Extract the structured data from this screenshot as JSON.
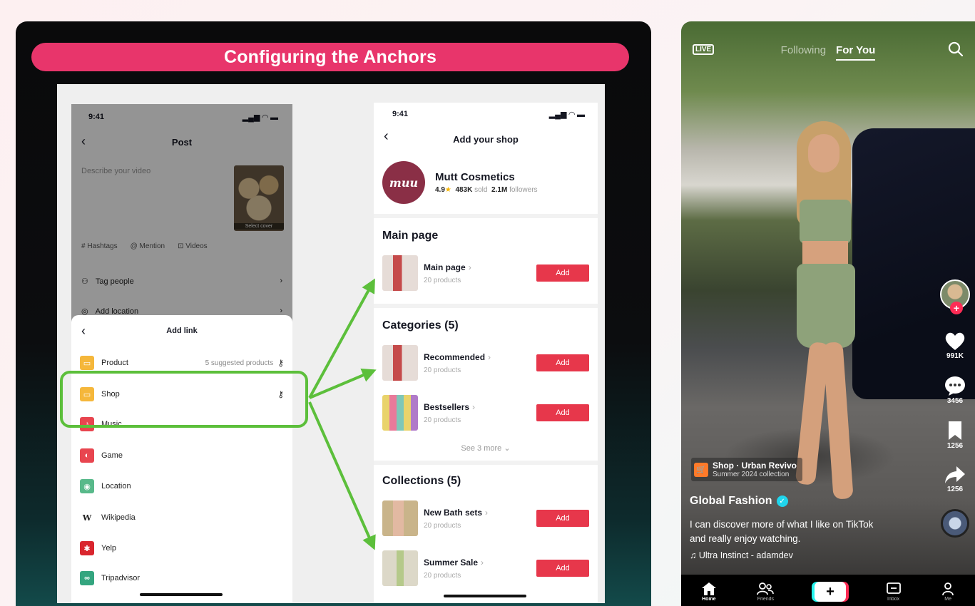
{
  "slide": {
    "banner": "Configuring the Anchors",
    "post_screen": {
      "time": "9:41",
      "title": "Post",
      "back": "‹",
      "description_placeholder": "Describe your video",
      "cover_label": "Select cover",
      "tags": [
        "# Hashtags",
        "@ Mention",
        "⊡ Videos"
      ],
      "tag_people": "Tag people",
      "add_location": "Add location"
    },
    "add_link_sheet": {
      "back": "‹",
      "title": "Add link",
      "items": [
        {
          "label": "Product",
          "right": "5 suggested products",
          "icon_color": "#f5b73b",
          "glyph": "▭"
        },
        {
          "label": "Shop",
          "right": "",
          "icon_color": "#f5b73b",
          "glyph": "▭"
        },
        {
          "label": "Music",
          "right": "",
          "icon_color": "#e8454f",
          "glyph": "♪"
        },
        {
          "label": "Game",
          "right": "",
          "icon_color": "#e8454f",
          "glyph": "◐"
        },
        {
          "label": "Location",
          "right": "",
          "icon_color": "#58b98a",
          "glyph": "◉"
        },
        {
          "label": "Wikipedia",
          "right": "",
          "icon_color": "#ffffff",
          "glyph": "W"
        },
        {
          "label": "Yelp",
          "right": "",
          "icon_color": "#d9262e",
          "glyph": "✱"
        },
        {
          "label": "Tripadvisor",
          "right": "",
          "icon_color": "#34a57f",
          "glyph": "∞"
        }
      ]
    },
    "shop_screen": {
      "time": "9:41",
      "back": "‹",
      "title": "Add your shop",
      "shop_logo_text": "muu",
      "shop_name": "Mutt Cosmetics",
      "rating": "4.9",
      "sold_value": "483K",
      "sold_label": "sold",
      "followers_value": "2.1M",
      "followers_label": "followers",
      "main_section": "Main page",
      "main_items": [
        {
          "name": "Main page",
          "count": "20 products",
          "add": "Add"
        }
      ],
      "categories_section": "Categories (5)",
      "category_items": [
        {
          "name": "Recommended",
          "count": "20 products",
          "add": "Add"
        },
        {
          "name": "Bestsellers",
          "count": "20 products",
          "add": "Add"
        }
      ],
      "see_more": "See 3 more ⌄",
      "collections_section": "Collections (5)",
      "collection_items": [
        {
          "name": "New Bath sets",
          "count": "20 products",
          "add": "Add"
        },
        {
          "name": "Summer Sale",
          "count": "20 products",
          "add": "Add"
        }
      ]
    }
  },
  "tiktok": {
    "live_label": "LIVE",
    "tab_following": "Following",
    "tab_for_you": "For You",
    "likes": "991K",
    "comments": "3456",
    "saves": "1256",
    "shares": "1256",
    "shop_tag_title": "Shop · Urban Revivo",
    "shop_tag_subtitle": "Summer 2024 collection",
    "author": "Global Fashion",
    "caption": "I can discover more of what I like on TikTok and really enjoy watching.",
    "music": "♫ Ultra Instinct - adamdev",
    "nav": {
      "home": "Home",
      "friends": "Friends",
      "inbox": "Inbox",
      "me": "Me"
    },
    "colors": {
      "accent_red": "#fe2c55",
      "accent_cyan": "#25f4ee",
      "banner_pink": "#e8356b",
      "highlight_green": "#5cbf3b"
    }
  }
}
